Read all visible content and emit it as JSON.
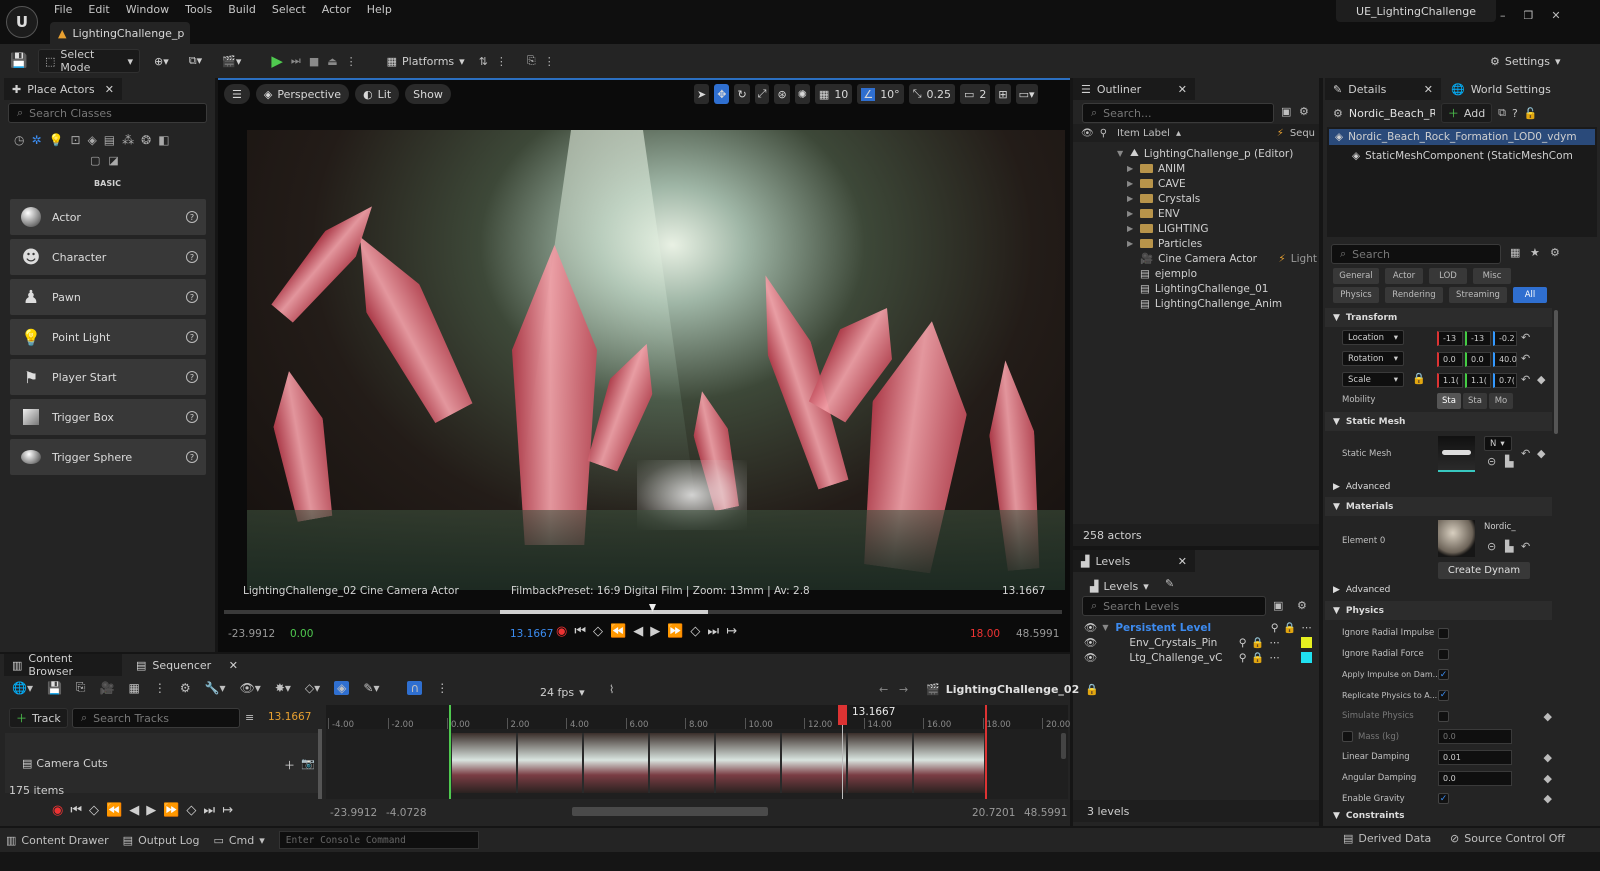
{
  "app": {
    "logo": "U",
    "project_name": "UE_LightingChallenge",
    "document_tab": "LightingChallenge_p"
  },
  "menu": [
    "File",
    "Edit",
    "Window",
    "Tools",
    "Build",
    "Select",
    "Actor",
    "Help"
  ],
  "toolbar": {
    "select_mode": "Select Mode",
    "platforms": "Platforms",
    "settings": "Settings"
  },
  "place_actors": {
    "tab": "Place Actors",
    "search_placeholder": "Search Classes",
    "category": "BASIC",
    "items": [
      "Actor",
      "Character",
      "Pawn",
      "Point Light",
      "Player Start",
      "Trigger Box",
      "Trigger Sphere"
    ]
  },
  "viewport": {
    "perspective": "Perspective",
    "lit": "Lit",
    "show": "Show",
    "grid": "10",
    "angle": "10°",
    "scale": "0.25",
    "camera_speed": "2",
    "camera_label": "LightingChallenge_02  Cine Camera Actor",
    "filmback": "FilmbackPreset: 16:9 Digital Film | Zoom: 13mm | Av: 2.8",
    "time": "13.1667",
    "range_start": "-23.9912",
    "offset": "0.00",
    "current": "13.1667",
    "end_red": "18.00",
    "range_end": "48.5991"
  },
  "outliner": {
    "tab": "Outliner",
    "search_placeholder": "Search...",
    "col_label": "Item Label",
    "col_type": "Sequ",
    "root": "LightingChallenge_p (Editor)",
    "folders": [
      "ANIM",
      "CAVE",
      "Crystals",
      "ENV",
      "LIGHTING",
      "Particles"
    ],
    "items": [
      {
        "name": "Cine Camera Actor",
        "tag": "Light"
      },
      {
        "name": "ejemplo",
        "tag": ""
      },
      {
        "name": "LightingChallenge_01",
        "tag": ""
      },
      {
        "name": "LightingChallenge_Anim",
        "tag": ""
      }
    ],
    "count": "258 actors"
  },
  "levels": {
    "tab": "Levels",
    "dropdown": "Levels",
    "search_placeholder": "Search Levels",
    "items": [
      {
        "name": "Persistent Level",
        "color": "#3d8bf0"
      },
      {
        "name": "Env_Crystals_Pin",
        "color": "#e6f020"
      },
      {
        "name": "Ltg_Challenge_vC",
        "color": "#20e0f0"
      }
    ],
    "count": "3 levels"
  },
  "details": {
    "tab": "Details",
    "tab2": "World Settings",
    "actor_name": "Nordic_Beach_R",
    "add": "Add",
    "components": [
      "Nordic_Beach_Rock_Formation_LOD0_vdym",
      "StaticMeshComponent (StaticMeshCom"
    ],
    "search_placeholder": "Search",
    "filters1": [
      "General",
      "Actor",
      "LOD",
      "Misc"
    ],
    "filters2": [
      "Physics",
      "Rendering",
      "Streaming",
      "All"
    ],
    "transform": {
      "title": "Transform",
      "location": {
        "label": "Location",
        "x": "-13",
        "y": "-13",
        "z": "-0.2"
      },
      "rotation": {
        "label": "Rotation",
        "x": "0.0",
        "y": "0.0",
        "z": "40.0"
      },
      "scale": {
        "label": "Scale",
        "x": "1.1(",
        "y": "1.1(",
        "z": "0.7("
      },
      "mobility": {
        "label": "Mobility",
        "options": [
          "Sta",
          "Sta",
          "Mo"
        ]
      }
    },
    "static_mesh": {
      "title": "Static Mesh",
      "label": "Static Mesh",
      "value": "N"
    },
    "advanced": "Advanced",
    "materials": {
      "title": "Materials",
      "element": "Element 0",
      "value": "Nordic_",
      "button": "Create Dynam"
    },
    "physics": {
      "title": "Physics",
      "rows": [
        {
          "label": "Ignore Radial Impulse",
          "type": "check",
          "value": ""
        },
        {
          "label": "Ignore Radial Force",
          "type": "check",
          "value": ""
        },
        {
          "label": "Apply Impulse on Dam...",
          "type": "check",
          "value": "✓"
        },
        {
          "label": "Replicate Physics to A...",
          "type": "check",
          "value": "✓"
        },
        {
          "label": "Simulate Physics",
          "type": "check",
          "value": ""
        },
        {
          "label": "Mass (kg)",
          "type": "num",
          "value": "0.0"
        },
        {
          "label": "Linear Damping",
          "type": "num",
          "value": "0.01"
        },
        {
          "label": "Angular Damping",
          "type": "num",
          "value": "0.0"
        },
        {
          "label": "Enable Gravity",
          "type": "check",
          "value": "✓"
        }
      ]
    },
    "constraints": "Constraints"
  },
  "sequencer": {
    "tab_content": "Content Browser",
    "tab_seq": "Sequencer",
    "fps": "24 fps",
    "sequence_name": "LightingChallenge_02",
    "add_track": "Track",
    "search_placeholder": "Search Tracks",
    "time": "13.1667",
    "track": "Camera Cuts",
    "items": "175 items",
    "playhead": "13.1667",
    "ticks": [
      "-4.00",
      "-2.00",
      "0.00",
      "2.00",
      "4.00",
      "6.00",
      "8.00",
      "10.00",
      "12.00",
      "14.00",
      "16.00",
      "18.00",
      "20.00"
    ],
    "bottom": {
      "a": "-23.9912",
      "b": "-4.0728",
      "c": "20.7201",
      "d": "48.5991"
    }
  },
  "status": {
    "drawer": "Content Drawer",
    "output": "Output Log",
    "cmd": "Cmd",
    "console_placeholder": "Enter Console Command",
    "derived": "Derived Data",
    "source_control": "Source Control Off"
  }
}
